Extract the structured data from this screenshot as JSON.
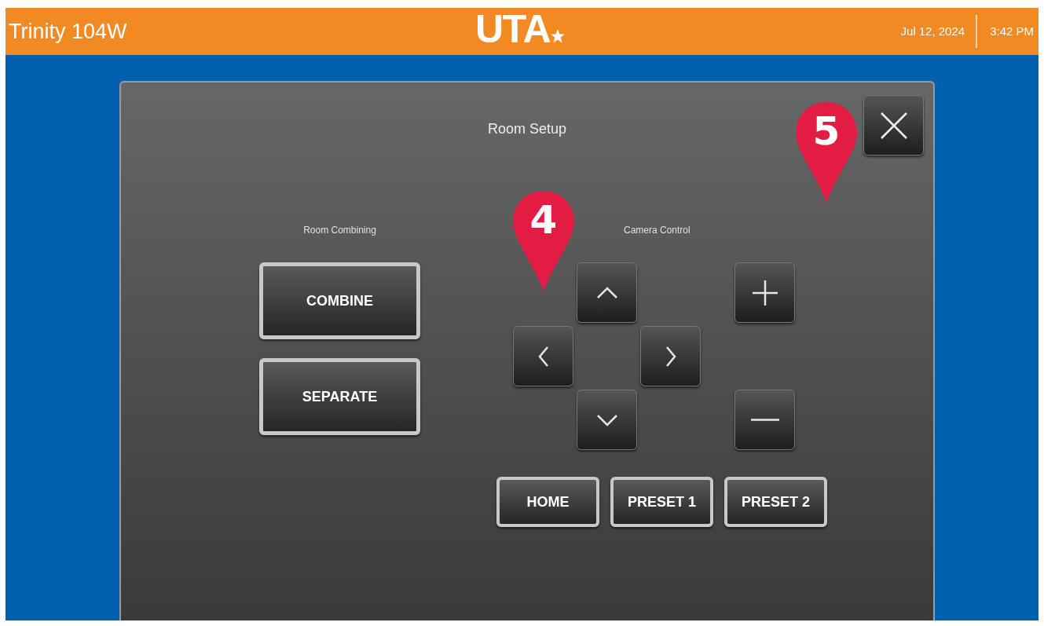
{
  "header": {
    "room": "Trinity 104W",
    "logo": "UTA",
    "date": "Jul 12, 2024",
    "time": "3:42 PM"
  },
  "dialog": {
    "title": "Room Setup",
    "room_combining": {
      "label": "Room Combining",
      "buttons": [
        "COMBINE",
        "SEPARATE"
      ]
    },
    "camera_control": {
      "label": "Camera Control",
      "presets": [
        "HOME",
        "PRESET 1",
        "PRESET 2"
      ]
    }
  },
  "annotations": [
    {
      "label": "4"
    },
    {
      "label": "5"
    }
  ]
}
